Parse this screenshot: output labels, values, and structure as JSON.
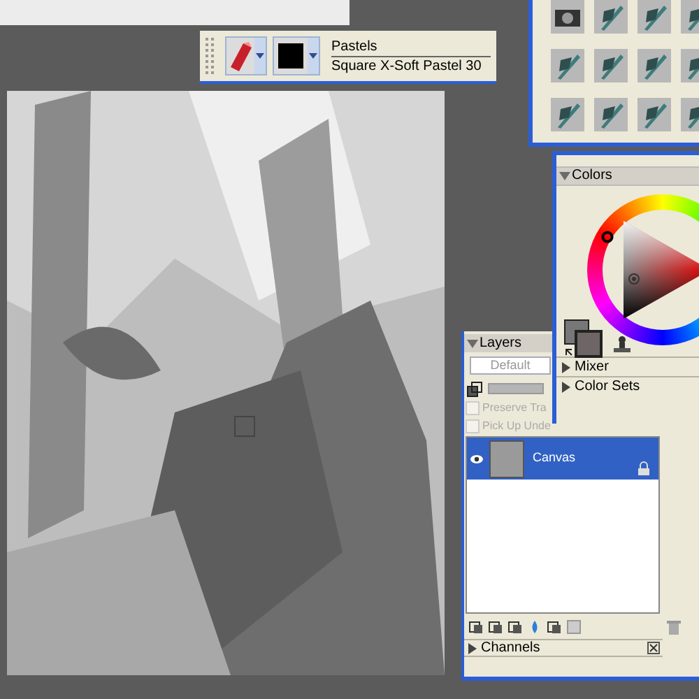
{
  "property_bar": {
    "category": "Pastels",
    "variant": "Square X-Soft Pastel 30"
  },
  "colors_panel": {
    "title": "Colors",
    "expanded": true,
    "sections": [
      {
        "label": "Mixer",
        "expanded": false
      },
      {
        "label": "Color Sets",
        "expanded": false
      }
    ]
  },
  "layers_panel": {
    "title": "Layers",
    "expanded": true,
    "composite_method": "Default",
    "opacity": {
      "level": 1
    },
    "options": [
      {
        "label": "Preserve Tra",
        "checked": false,
        "disabled": true
      },
      {
        "label": "Pick Up Unde",
        "checked": false,
        "disabled": true
      }
    ],
    "layers": [
      {
        "name": "Canvas",
        "selected": true,
        "visible": true,
        "locked": true
      }
    ]
  },
  "channels_panel": {
    "title": "Channels",
    "expanded": false
  }
}
